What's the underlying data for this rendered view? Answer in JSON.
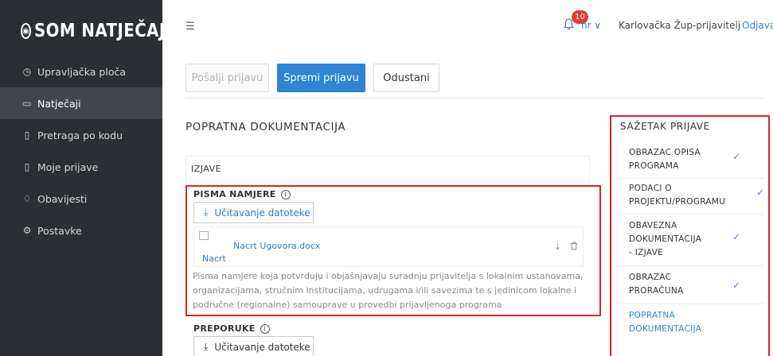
{
  "app": {
    "logo_text": "SOM NATJEČAJI"
  },
  "sidebar": {
    "items": [
      {
        "label": "Upravljačka ploča",
        "icon": "dashboard-icon",
        "glyph": "◷",
        "active": false
      },
      {
        "label": "Natječaji",
        "icon": "folder-icon",
        "glyph": "▭",
        "active": true
      },
      {
        "label": "Pretraga po kodu",
        "icon": "document-search-icon",
        "glyph": "▯",
        "active": false
      },
      {
        "label": "Moje prijave",
        "icon": "document-icon",
        "glyph": "▯",
        "active": false
      },
      {
        "label": "Obavijesti",
        "icon": "bell-icon",
        "glyph": "♢",
        "active": false
      },
      {
        "label": "Postavke",
        "icon": "gear-icon",
        "glyph": "⚙",
        "active": false
      }
    ]
  },
  "header": {
    "notifications_count": "10",
    "language": "hr ∨",
    "user_name": "Karlovačka Žup-prijavitelj",
    "logout_label": "Odjava"
  },
  "actions": {
    "send_label": "Pošalji prijavu",
    "save_label": "Spremi prijavu",
    "cancel_label": "Odustani"
  },
  "main": {
    "section_title": "POPRATNA DOKUMENTACIJA",
    "subsection_label": "IZJAVE",
    "groups": {
      "letters": {
        "label": "PISMA NAMJERE",
        "upload_label": "Učitavanje datoteke",
        "file": {
          "image_alt": "Nacrt",
          "name": "Nacrt Ugovora.docx"
        },
        "description": "Pisma namjere koja potvrđuju i objašnjavaju suradnju prijavitelja s lokalnim ustanovama, organizacijama, stručnim institucijama, udrugama i/ili savezima te s jedinicom lokalne i područne (regionalne) samouprave u provedbi prijavljenoga programa"
      },
      "recommendations": {
        "label": "PREPORUKE",
        "upload_label": "Učitavanje datoteke"
      }
    }
  },
  "summary": {
    "title": "SAŽETAK PRIJAVE",
    "items": [
      {
        "line1": "OBRAZAC OPISA",
        "line2": "PROGRAMA",
        "line3": "",
        "completed": true,
        "current": false
      },
      {
        "line1": "PODACI O",
        "line2": "PROJEKTU/PROGRAMU",
        "line3": "",
        "completed": true,
        "current": false
      },
      {
        "line1": "OBAVEZNA",
        "line2": "DOKUMENTACIJA",
        "line3": "- IZJAVE",
        "completed": true,
        "current": false
      },
      {
        "line1": "OBRAZAC",
        "line2": "PRORAČUNA",
        "line3": "",
        "completed": true,
        "current": false
      },
      {
        "line1": "POPRATNA",
        "line2": "DOKUMENTACIJA",
        "line3": "",
        "completed": false,
        "current": true
      }
    ]
  },
  "colors": {
    "accent": "#2f84d6",
    "highlight_border": "#d9242a",
    "sidebar_bg": "#2b2f33",
    "sidebar_active_bg": "#41464c",
    "badge": "#e53935"
  }
}
